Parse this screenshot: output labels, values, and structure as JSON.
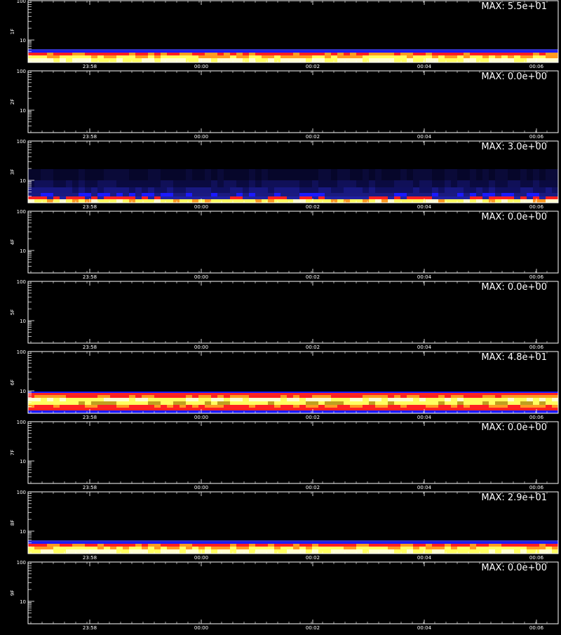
{
  "chart_data": [
    {
      "type": "heatmap",
      "ylabel": "1F",
      "max_label": "MAX: 5.5e+01",
      "max": 55.0,
      "yticks": [
        "100",
        "10"
      ],
      "xticks": [
        "23:58",
        "00:00",
        "00:02",
        "00:04",
        "00:06"
      ],
      "band": "low-bright"
    },
    {
      "type": "heatmap",
      "ylabel": "2F",
      "max_label": "MAX: 0.0e+00",
      "max": 0.0,
      "yticks": [
        "100",
        "10"
      ],
      "xticks": [
        "23:58",
        "00:00",
        "00:02",
        "00:04",
        "00:06"
      ],
      "band": "none"
    },
    {
      "type": "heatmap",
      "ylabel": "3F",
      "max_label": "MAX: 3.0e+00",
      "max": 3.0,
      "yticks": [
        "100",
        "10"
      ],
      "xticks": [
        "23:58",
        "00:00",
        "00:02",
        "00:04",
        "00:06"
      ],
      "band": "noisy"
    },
    {
      "type": "heatmap",
      "ylabel": "4F",
      "max_label": "MAX: 0.0e+00",
      "max": 0.0,
      "yticks": [
        "100",
        "10"
      ],
      "xticks": [
        "23:58",
        "00:00",
        "00:02",
        "00:04",
        "00:06"
      ],
      "band": "none"
    },
    {
      "type": "heatmap",
      "ylabel": "5F",
      "max_label": "MAX: 0.0e+00",
      "max": 0.0,
      "yticks": [
        "100",
        "10"
      ],
      "xticks": [
        "23:58",
        "00:00",
        "00:02",
        "00:04",
        "00:06"
      ],
      "band": "none"
    },
    {
      "type": "heatmap",
      "ylabel": "6F",
      "max_label": "MAX: 4.8e+01",
      "max": 48.0,
      "yticks": [
        "100",
        "10"
      ],
      "xticks": [
        "23:58",
        "00:00",
        "00:02",
        "00:04",
        "00:06"
      ],
      "band": "mid-bright"
    },
    {
      "type": "heatmap",
      "ylabel": "7F",
      "max_label": "MAX: 0.0e+00",
      "max": 0.0,
      "yticks": [
        "100",
        "10"
      ],
      "xticks": [
        "23:58",
        "00:00",
        "00:02",
        "00:04",
        "00:06"
      ],
      "band": "none"
    },
    {
      "type": "heatmap",
      "ylabel": "8F",
      "max_label": "MAX: 2.9e+01",
      "max": 29.0,
      "yticks": [
        "100",
        "10"
      ],
      "xticks": [
        "23:58",
        "00:00",
        "00:02",
        "00:04",
        "00:06"
      ],
      "band": "low-bright"
    },
    {
      "type": "heatmap",
      "ylabel": "9F",
      "max_label": "MAX: 0.0e+00",
      "max": 0.0,
      "yticks": [
        "100",
        "10"
      ],
      "xticks": [
        "23:58",
        "00:00",
        "00:02",
        "00:04",
        "00:06"
      ],
      "band": "none"
    }
  ],
  "footer": "",
  "colors": {
    "background": "#000000",
    "axes": "#ffffff",
    "low": "#0a0a3a",
    "blue": "#1a1aff",
    "red": "#ff2020",
    "orange": "#ff9a20",
    "yellow": "#ffff60",
    "white": "#ffffd0"
  }
}
